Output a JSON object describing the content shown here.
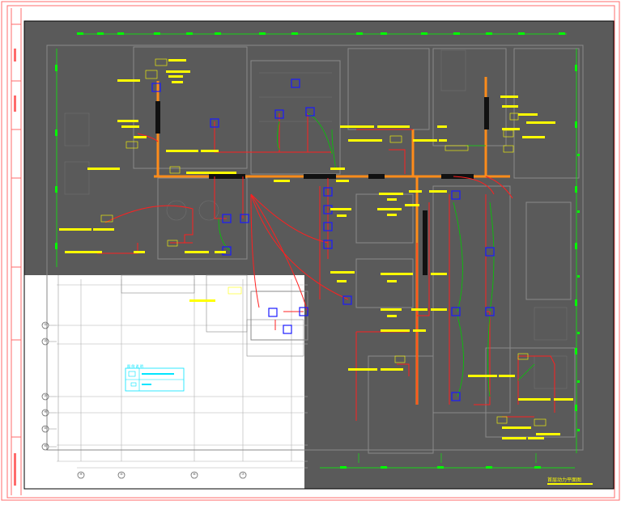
{
  "drawing": {
    "title": "首层动力平面图",
    "legend_title": "图 例 说 明"
  },
  "grid_labels_left": [
    "①",
    "②",
    "③",
    "④",
    "⑤",
    "⑥"
  ],
  "grid_labels_bottom": [
    "④",
    "⑤",
    "⑥",
    "⑦"
  ],
  "colors": {
    "background_dark": "#5b5b5b",
    "frame_red": "#ff6b6b",
    "cable_red": "#ff2020",
    "tray_orange": "#ff8c1a",
    "label_yellow": "#ffff00",
    "dim_green": "#00ff00",
    "device_blue": "#1a1aff",
    "legend_cyan": "#00e5ff",
    "plan_grey": "#9a9a9a",
    "white_paper": "#ffffff"
  }
}
